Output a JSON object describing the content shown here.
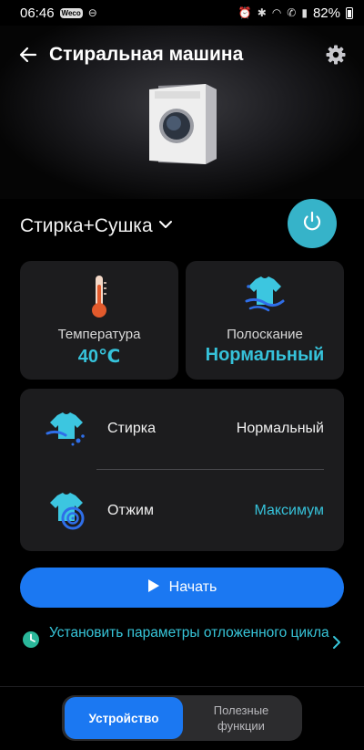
{
  "status_bar": {
    "time": "06:46",
    "notif_badge": "Weco",
    "battery": "82%"
  },
  "app_bar": {
    "title": "Стиральная машина"
  },
  "mode": {
    "label": "Стирка+Сушка"
  },
  "cards": {
    "temperature": {
      "label": "Температура",
      "value": "40℃"
    },
    "rinse": {
      "label": "Полоскание",
      "value": "Нормальный"
    }
  },
  "settings": {
    "wash": {
      "label": "Стирка",
      "value": "Нормальный"
    },
    "spin": {
      "label": "Отжим",
      "value": "Максимум"
    }
  },
  "start_button": {
    "label": "Начать"
  },
  "delay": {
    "text": "Установить параметры отложенного цикла"
  },
  "tabs": {
    "device": "Устройство",
    "useful": "Полезные функции"
  },
  "colors": {
    "accent": "#36c2da",
    "primary": "#1b78f2",
    "card_bg": "#1c1c1e"
  }
}
